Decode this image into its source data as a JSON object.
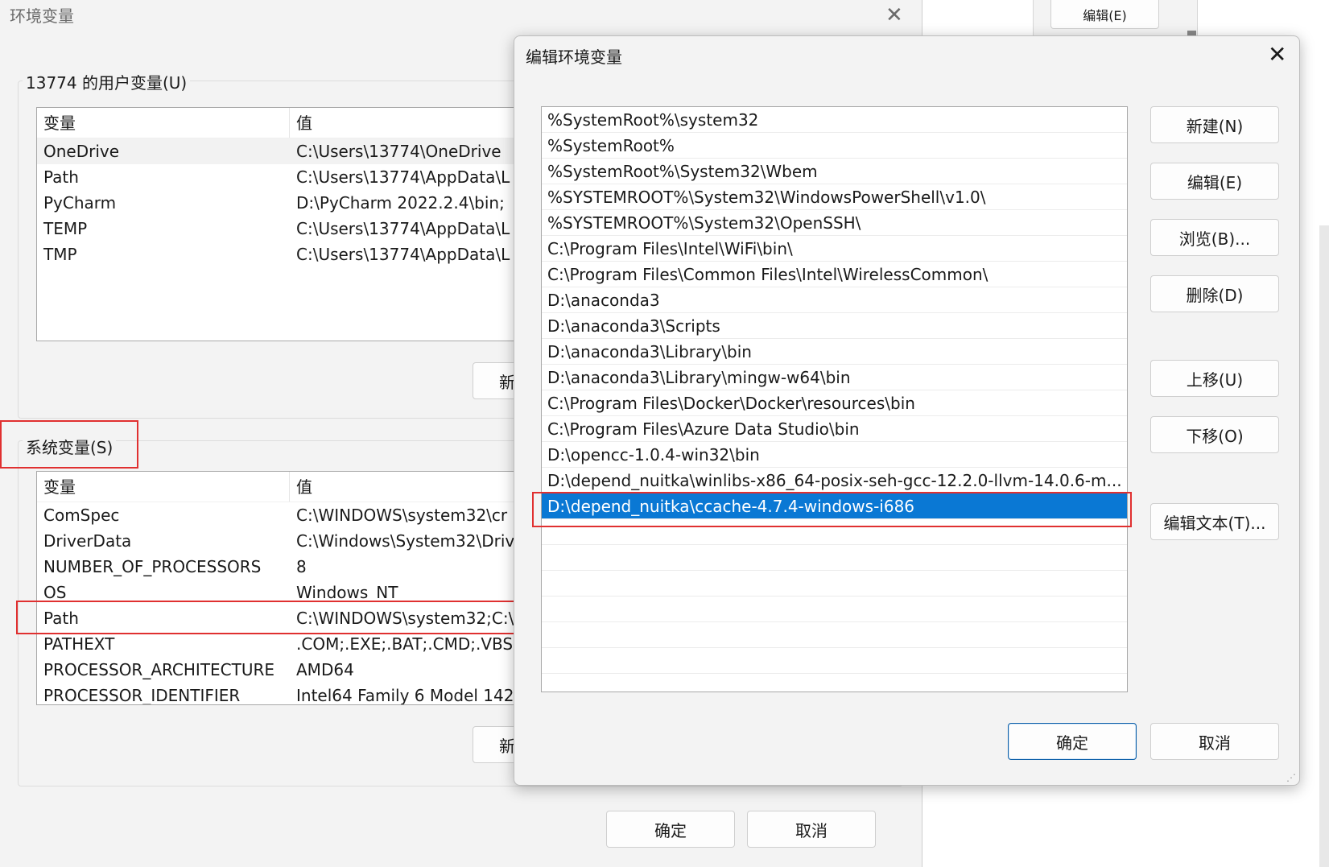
{
  "background": {
    "edit_button_label": "编辑(E)"
  },
  "main_window": {
    "title": "环境变量",
    "close_glyph": "✕",
    "user_section": {
      "label": "13774 的用户变量(U)",
      "header_var": "变量",
      "header_val": "值",
      "rows": [
        {
          "name": "OneDrive",
          "value": "C:\\Users\\13774\\OneDrive"
        },
        {
          "name": "Path",
          "value": "C:\\Users\\13774\\AppData\\L"
        },
        {
          "name": "PyCharm",
          "value": "D:\\PyCharm 2022.2.4\\bin;"
        },
        {
          "name": "TEMP",
          "value": "C:\\Users\\13774\\AppData\\L"
        },
        {
          "name": "TMP",
          "value": "C:\\Users\\13774\\AppData\\L"
        }
      ],
      "new_button_partial": "新"
    },
    "system_section": {
      "label": "系统变量(S)",
      "header_var": "变量",
      "header_val": "值",
      "rows": [
        {
          "name": "ComSpec",
          "value": "C:\\WINDOWS\\system32\\cr"
        },
        {
          "name": "DriverData",
          "value": "C:\\Windows\\System32\\Driv"
        },
        {
          "name": "NUMBER_OF_PROCESSORS",
          "value": "8"
        },
        {
          "name": "OS",
          "value": "Windows_NT"
        },
        {
          "name": "Path",
          "value": "C:\\WINDOWS\\system32;C:\\"
        },
        {
          "name": "PATHEXT",
          "value": ".COM;.EXE;.BAT;.CMD;.VBS;"
        },
        {
          "name": "PROCESSOR_ARCHITECTURE",
          "value": "AMD64"
        },
        {
          "name": "PROCESSOR_IDENTIFIER",
          "value": "Intel64 Family 6 Model 142"
        }
      ],
      "new_button_partial": "新"
    },
    "ok_label": "确定",
    "cancel_label": "取消"
  },
  "edit_dialog": {
    "title": "编辑环境变量",
    "close_glyph": "✕",
    "paths": [
      "%SystemRoot%\\system32",
      "%SystemRoot%",
      "%SystemRoot%\\System32\\Wbem",
      "%SYSTEMROOT%\\System32\\WindowsPowerShell\\v1.0\\",
      "%SYSTEMROOT%\\System32\\OpenSSH\\",
      "C:\\Program Files\\Intel\\WiFi\\bin\\",
      "C:\\Program Files\\Common Files\\Intel\\WirelessCommon\\",
      "D:\\anaconda3",
      "D:\\anaconda3\\Scripts",
      "D:\\anaconda3\\Library\\bin",
      "D:\\anaconda3\\Library\\mingw-w64\\bin",
      "C:\\Program Files\\Docker\\Docker\\resources\\bin",
      "C:\\Program Files\\Azure Data Studio\\bin",
      "D:\\opencc-1.0.4-win32\\bin",
      "D:\\depend_nuitka\\winlibs-x86_64-posix-seh-gcc-12.2.0-llvm-14.0.6-m...",
      "D:\\depend_nuitka\\ccache-4.7.4-windows-i686"
    ],
    "selected_index": 15,
    "buttons": {
      "new": "新建(N)",
      "edit": "编辑(E)",
      "browse": "浏览(B)...",
      "delete": "删除(D)",
      "move_up": "上移(U)",
      "move_down": "下移(O)",
      "edit_text": "编辑文本(T)..."
    },
    "ok_label": "确定",
    "cancel_label": "取消"
  },
  "colors": {
    "selection": "#0a78d4",
    "highlight_box": "#e03030"
  }
}
